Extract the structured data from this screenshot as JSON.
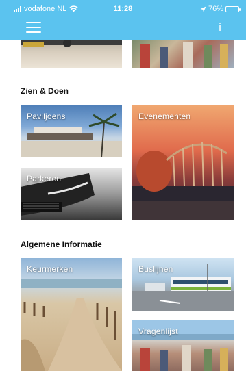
{
  "status_bar": {
    "carrier": "vodafone NL",
    "time": "11:28",
    "battery": "76%",
    "battery_level": 0.76
  },
  "header": {
    "menu_icon": "hamburger-menu-icon",
    "info_label": "i"
  },
  "sections": [
    {
      "title": "Zien & Doen",
      "tiles": [
        "Paviljoens",
        "Evenementen",
        "Parkeren"
      ]
    },
    {
      "title": "Algemene Informatie",
      "tiles": [
        "Keurmerken",
        "Buslijnen",
        "Vragenlijst"
      ]
    }
  ],
  "colors": {
    "header": "#5bc3ef",
    "title_text": "#111111",
    "tile_label": "#ffffff"
  }
}
